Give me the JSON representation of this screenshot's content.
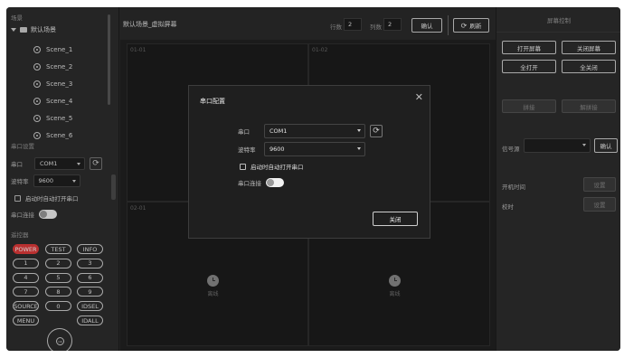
{
  "left": {
    "scene_section_title": "场景",
    "tree_root": "默认场景",
    "scenes": [
      "Scene_1",
      "Scene_2",
      "Scene_3",
      "Scene_4",
      "Scene_5",
      "Scene_6"
    ],
    "serial_section_title": "串口设置",
    "port_label": "串口",
    "port_value": "COM1",
    "baud_label": "波特率",
    "baud_value": "9600",
    "auto_open_label": "启动时自动打开串口",
    "connect_label": "串口连接",
    "remote_section_title": "遥控器",
    "remote_rows": [
      [
        "POWER",
        "TEST",
        "INFO"
      ],
      [
        "1",
        "2",
        "3"
      ],
      [
        "4",
        "5",
        "6"
      ],
      [
        "7",
        "8",
        "9"
      ],
      [
        "SOURCE",
        "0",
        "IDSEL"
      ],
      [
        "MENU",
        "",
        "IDALL"
      ]
    ],
    "dpad_center": "OK"
  },
  "center": {
    "title": "默认场景_虚拟屏幕",
    "rows_label": "行数",
    "rows_value": "2",
    "cols_label": "列数",
    "cols_value": "2",
    "confirm_label": "确认",
    "refresh_label": "刷新",
    "cells": [
      "01-01",
      "01-02",
      "02-01",
      ""
    ],
    "offline_label": "离线"
  },
  "right": {
    "header": "屏幕控制",
    "open_screen": "打开屏幕",
    "close_screen": "关闭屏幕",
    "all_open": "全打开",
    "all_close": "全关闭",
    "splice": "拼接",
    "unsplice": "解拼接",
    "signal_label": "信号源",
    "signal_confirm": "确认",
    "power_time_label": "开机时间",
    "timing_label": "校时",
    "set_label": "设置"
  },
  "modal": {
    "title": "串口配置",
    "port_label": "串口",
    "port_value": "COM1",
    "baud_label": "波特率",
    "baud_value": "9600",
    "auto_open_label": "启动时自动打开串口",
    "connect_label": "串口连接",
    "close_button": "关闭"
  }
}
